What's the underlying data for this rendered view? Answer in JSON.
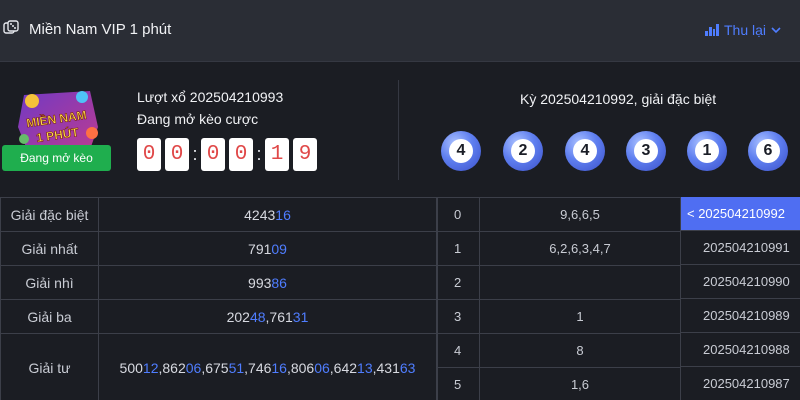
{
  "header": {
    "title": "Miền Nam VIP 1 phút",
    "collapse_label": "Thu lại",
    "colors": {
      "accent": "#4f7dff"
    }
  },
  "current": {
    "round_label": "Lượt xổ 202504210993",
    "status_label": "Đang mở kèo cược",
    "badge": "Đang mở kèo",
    "logo_text_1": "MIỀN NAM",
    "logo_text_2": "1 PHÚT",
    "timer": [
      "0",
      "0",
      "0",
      "0",
      "1",
      "9"
    ]
  },
  "last": {
    "label": "Kỳ 202504210992, giải đặc biệt",
    "balls": [
      "4",
      "2",
      "4",
      "3",
      "1",
      "6"
    ]
  },
  "prizes": [
    {
      "name": "Giải đặc biệt",
      "parts": [
        {
          "t": "4243",
          "h": false
        },
        {
          "t": "16",
          "h": true
        }
      ]
    },
    {
      "name": "Giải nhất",
      "parts": [
        {
          "t": "791",
          "h": false
        },
        {
          "t": "09",
          "h": true
        }
      ]
    },
    {
      "name": "Giải nhì",
      "parts": [
        {
          "t": "993",
          "h": false
        },
        {
          "t": "86",
          "h": true
        }
      ]
    },
    {
      "name": "Giải ba",
      "parts": [
        {
          "t": "202",
          "h": false
        },
        {
          "t": "48",
          "h": true
        },
        {
          "t": ",761",
          "h": false
        },
        {
          "t": "31",
          "h": true
        }
      ]
    },
    {
      "name": "Giải tư",
      "parts": [
        {
          "t": "500",
          "h": false
        },
        {
          "t": "12",
          "h": true
        },
        {
          "t": ",862",
          "h": false
        },
        {
          "t": "06",
          "h": true
        },
        {
          "t": ",675",
          "h": false
        },
        {
          "t": "51",
          "h": true
        },
        {
          "t": ",746",
          "h": false
        },
        {
          "t": "16",
          "h": true
        },
        {
          "t": ",806",
          "h": false
        },
        {
          "t": "06",
          "h": true
        },
        {
          "t": ",642",
          "h": false
        },
        {
          "t": "13",
          "h": true
        },
        {
          "t": ",431",
          "h": false
        },
        {
          "t": "63",
          "h": true
        }
      ]
    }
  ],
  "loto": [
    {
      "head": "0",
      "tail": "9,6,6,5"
    },
    {
      "head": "1",
      "tail": "6,2,6,3,4,7"
    },
    {
      "head": "2",
      "tail": ""
    },
    {
      "head": "3",
      "tail": "1"
    },
    {
      "head": "4",
      "tail": "8"
    },
    {
      "head": "5",
      "tail": "1,6"
    }
  ],
  "history": [
    {
      "id": "< 202504210992",
      "active": true
    },
    {
      "id": "202504210991",
      "active": false
    },
    {
      "id": "202504210990",
      "active": false
    },
    {
      "id": "202504210989",
      "active": false
    },
    {
      "id": "202504210988",
      "active": false
    },
    {
      "id": "202504210987",
      "active": false
    }
  ]
}
